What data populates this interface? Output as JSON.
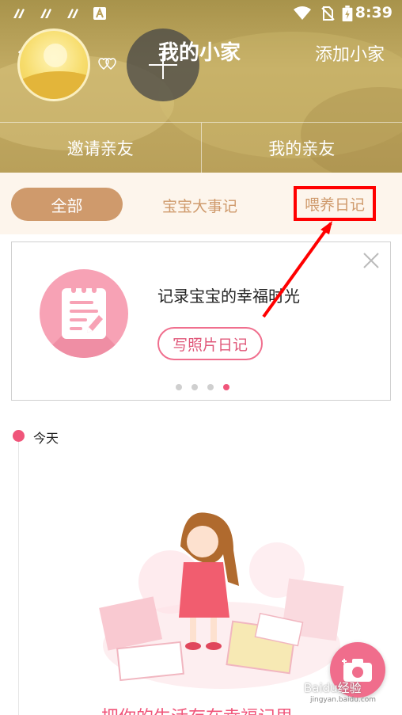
{
  "status_bar": {
    "time": "8:39",
    "icons": [
      "notification-icon",
      "notification-icon",
      "notification-icon",
      "a-icon",
      "wifi-icon",
      "no-sim-icon",
      "battery-icon"
    ]
  },
  "header": {
    "title": "我的小家",
    "add_home_label": "添加小家",
    "invite_label": "邀请亲友",
    "my_relatives_label": "我的亲友"
  },
  "tabs": {
    "all_label": "全部",
    "baby_events_label": "宝宝大事记",
    "feeding_diary_label": "喂养日记"
  },
  "card": {
    "text": "记录宝宝的幸福时光",
    "button_label": "写照片日记",
    "page_count": 4,
    "active_page": 4
  },
  "timeline": {
    "today_label": "今天"
  },
  "bottom": {
    "text": "把你的生活存在幸福记里"
  },
  "watermark": {
    "text": "Baidu经验",
    "sub": "jingyan.baidu.com"
  },
  "colors": {
    "accent_pink": "#f0557a",
    "tab_brown": "#cf9a6c",
    "highlight_red": "#ff0000"
  }
}
